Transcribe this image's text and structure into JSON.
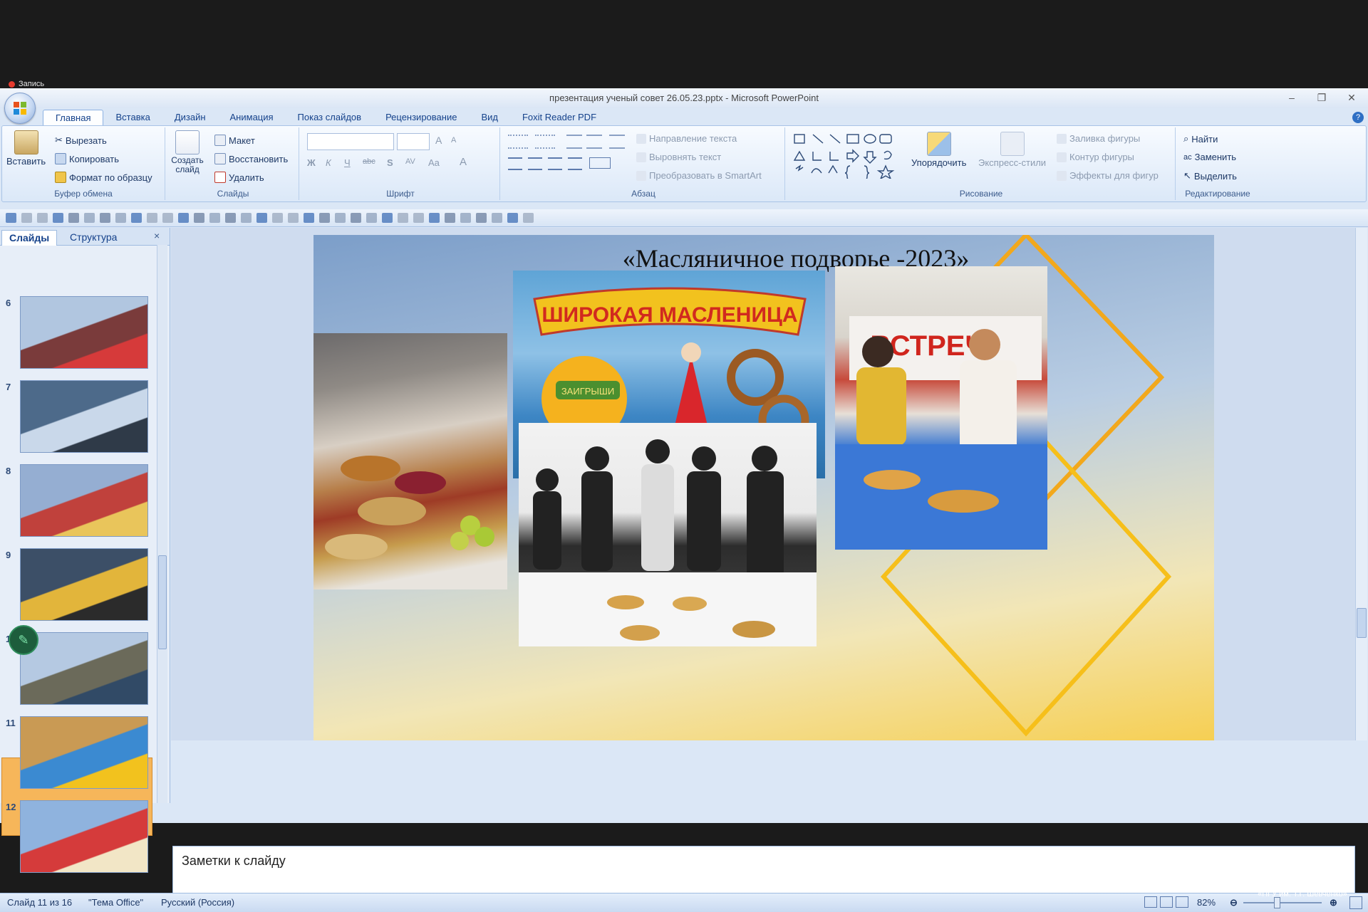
{
  "recording": {
    "label": "Запись"
  },
  "window": {
    "title": "презентация ученый совет 26.05.23.pptx - Microsoft PowerPoint",
    "minimize": "–",
    "restore": "❐",
    "close": "✕"
  },
  "tabs": [
    "Главная",
    "Вставка",
    "Дизайн",
    "Анимация",
    "Показ слайдов",
    "Рецензирование",
    "Вид",
    "Foxit Reader PDF"
  ],
  "ribbon": {
    "clipboard": {
      "label": "Буфер обмена",
      "paste": "Вставить",
      "cut": "Вырезать",
      "copy": "Копировать",
      "format_painter": "Формат по образцу"
    },
    "slides": {
      "label": "Слайды",
      "new_slide": "Создать слайд",
      "layout": "Макет",
      "reset": "Восстановить",
      "delete": "Удалить"
    },
    "font": {
      "label": "Шрифт"
    },
    "paragraph": {
      "label": "Абзац",
      "text_direction": "Направление текста",
      "align_text": "Выровнять текст",
      "smartart": "Преобразовать в SmartArt"
    },
    "drawing": {
      "label": "Рисование",
      "arrange": "Упорядочить",
      "quick_styles": "Экспресс-стили",
      "shape_fill": "Заливка фигуры",
      "shape_outline": "Контур фигуры",
      "shape_effects": "Эффекты для фигур"
    },
    "editing": {
      "label": "Редактирование",
      "find": "Найти",
      "replace": "Заменить",
      "select": "Выделить"
    }
  },
  "left_panel": {
    "tab_slides": "Слайды",
    "tab_outline": "Структура",
    "close": "×",
    "slides": [
      {
        "num": "6"
      },
      {
        "num": "7"
      },
      {
        "num": "8"
      },
      {
        "num": "9"
      },
      {
        "num": "10"
      },
      {
        "num": "11"
      },
      {
        "num": "12"
      }
    ],
    "selected": "11"
  },
  "slide": {
    "title": "«Масляничное подворье -2023»",
    "banner_text": "ШИРОКАЯ МАСЛЕНИЦА",
    "banner_sub": "ЗАИГРЫШИ",
    "sign_text": "ВСТРЕЧ"
  },
  "notes": {
    "placeholder": "Заметки к слайду"
  },
  "status": {
    "slide_counter": "Слайд 11 из 16",
    "theme": "\"Тема Office\"",
    "language": "Русский (Россия)",
    "zoom": "82%"
  },
  "footer": {
    "line1": "БПФ ГОУ",
    "line2": "«ПГУ им. Т.Г. Шевченко»"
  }
}
